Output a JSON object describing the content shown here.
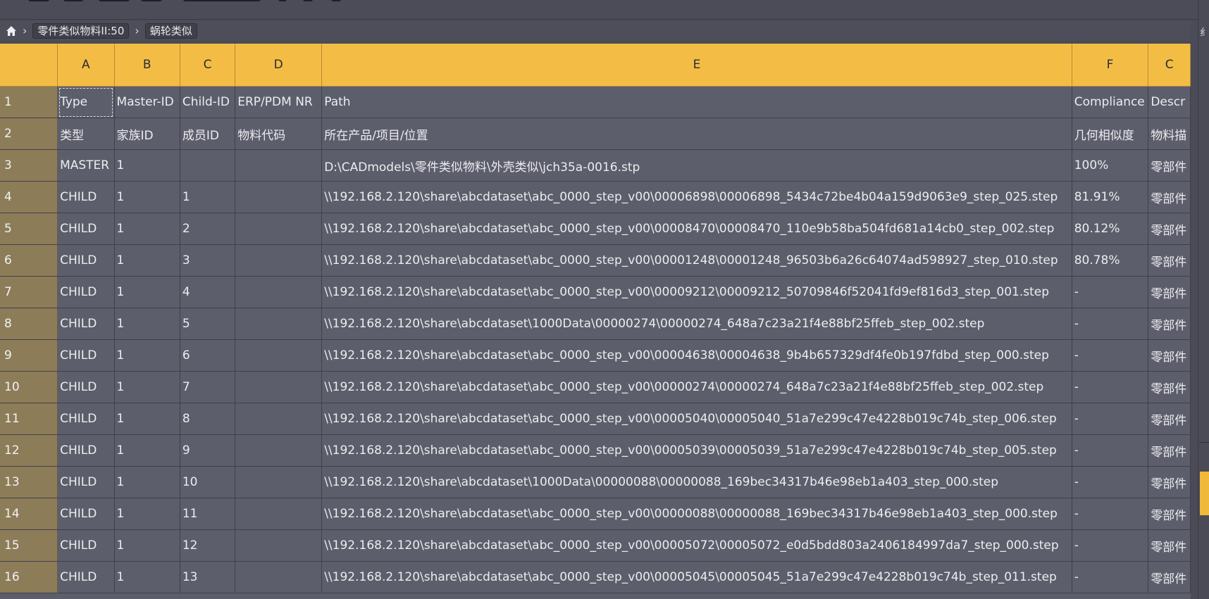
{
  "breadcrumb": {
    "items": [
      "零件类似物料II:50",
      "蜗轮类似"
    ]
  },
  "right_strip": {
    "edge_char": "纟"
  },
  "sheet": {
    "columns": [
      "A",
      "B",
      "C",
      "D",
      "E",
      "F",
      "C"
    ],
    "rows": [
      {
        "num": "1",
        "cells": [
          "Type",
          "Master-ID",
          "Child-ID",
          "ERP/PDM NR",
          "Path",
          "Compliance",
          "Descr"
        ]
      },
      {
        "num": "2",
        "cells": [
          "类型",
          "家族ID",
          "成员ID",
          "物料代码",
          "所在产品/项目/位置",
          "几何相似度",
          "物料描"
        ]
      },
      {
        "num": "3",
        "cells": [
          "MASTER",
          "1",
          "",
          "",
          "D:\\CADmodels\\零件类似物料\\外壳类似\\jch35a-0016.stp",
          "100%",
          "零部件"
        ]
      },
      {
        "num": "4",
        "cells": [
          "CHILD",
          "1",
          "1",
          "",
          "\\\\192.168.2.120\\share\\abcdataset\\abc_0000_step_v00\\00006898\\00006898_5434c72be4b04a159d9063e9_step_025.step",
          "81.91%",
          "零部件"
        ]
      },
      {
        "num": "5",
        "cells": [
          "CHILD",
          "1",
          "2",
          "",
          "\\\\192.168.2.120\\share\\abcdataset\\abc_0000_step_v00\\00008470\\00008470_110e9b58ba504fd681a14cb0_step_002.step",
          "80.12%",
          "零部件"
        ]
      },
      {
        "num": "6",
        "cells": [
          "CHILD",
          "1",
          "3",
          "",
          "\\\\192.168.2.120\\share\\abcdataset\\abc_0000_step_v00\\00001248\\00001248_96503b6a26c64074ad598927_step_010.step",
          "80.78%",
          "零部件"
        ]
      },
      {
        "num": "7",
        "cells": [
          "CHILD",
          "1",
          "4",
          "",
          "\\\\192.168.2.120\\share\\abcdataset\\abc_0000_step_v00\\00009212\\00009212_50709846f52041fd9ef816d3_step_001.step",
          "-",
          "零部件"
        ]
      },
      {
        "num": "8",
        "cells": [
          "CHILD",
          "1",
          "5",
          "",
          "\\\\192.168.2.120\\share\\abcdataset\\1000Data\\00000274\\00000274_648a7c23a21f4e88bf25ffeb_step_002.step",
          "-",
          "零部件"
        ]
      },
      {
        "num": "9",
        "cells": [
          "CHILD",
          "1",
          "6",
          "",
          "\\\\192.168.2.120\\share\\abcdataset\\abc_0000_step_v00\\00004638\\00004638_9b4b657329df4fe0b197fdbd_step_000.step",
          "-",
          "零部件"
        ]
      },
      {
        "num": "10",
        "cells": [
          "CHILD",
          "1",
          "7",
          "",
          "\\\\192.168.2.120\\share\\abcdataset\\abc_0000_step_v00\\00000274\\00000274_648a7c23a21f4e88bf25ffeb_step_002.step",
          "-",
          "零部件"
        ]
      },
      {
        "num": "11",
        "cells": [
          "CHILD",
          "1",
          "8",
          "",
          "\\\\192.168.2.120\\share\\abcdataset\\abc_0000_step_v00\\00005040\\00005040_51a7e299c47e4228b019c74b_step_006.step",
          "-",
          "零部件"
        ]
      },
      {
        "num": "12",
        "cells": [
          "CHILD",
          "1",
          "9",
          "",
          "\\\\192.168.2.120\\share\\abcdataset\\abc_0000_step_v00\\00005039\\00005039_51a7e299c47e4228b019c74b_step_005.step",
          "-",
          "零部件"
        ]
      },
      {
        "num": "13",
        "cells": [
          "CHILD",
          "1",
          "10",
          "",
          "\\\\192.168.2.120\\share\\abcdataset\\1000Data\\00000088\\00000088_169bec34317b46e98eb1a403_step_000.step",
          "-",
          "零部件"
        ]
      },
      {
        "num": "14",
        "cells": [
          "CHILD",
          "1",
          "11",
          "",
          "\\\\192.168.2.120\\share\\abcdataset\\abc_0000_step_v00\\00000088\\00000088_169bec34317b46e98eb1a403_step_000.step",
          "-",
          "零部件"
        ]
      },
      {
        "num": "15",
        "cells": [
          "CHILD",
          "1",
          "12",
          "",
          "\\\\192.168.2.120\\share\\abcdataset\\abc_0000_step_v00\\00005072\\00005072_e0d5bdd803a2406184997da7_step_000.step",
          "-",
          "零部件"
        ]
      },
      {
        "num": "16",
        "cells": [
          "CHILD",
          "1",
          "13",
          "",
          "\\\\192.168.2.120\\share\\abcdataset\\abc_0000_step_v00\\00005045\\00005045_51a7e299c47e4228b019c74b_step_011.step",
          "-",
          "零部件"
        ]
      }
    ]
  },
  "icons": {
    "home": "home-icon",
    "separator": "chevron-right-icon"
  },
  "colors": {
    "header": "#f3bd45",
    "row_header": "#8c7c58",
    "cell_bg": "#5d5e6b",
    "text": "#ececf0"
  }
}
